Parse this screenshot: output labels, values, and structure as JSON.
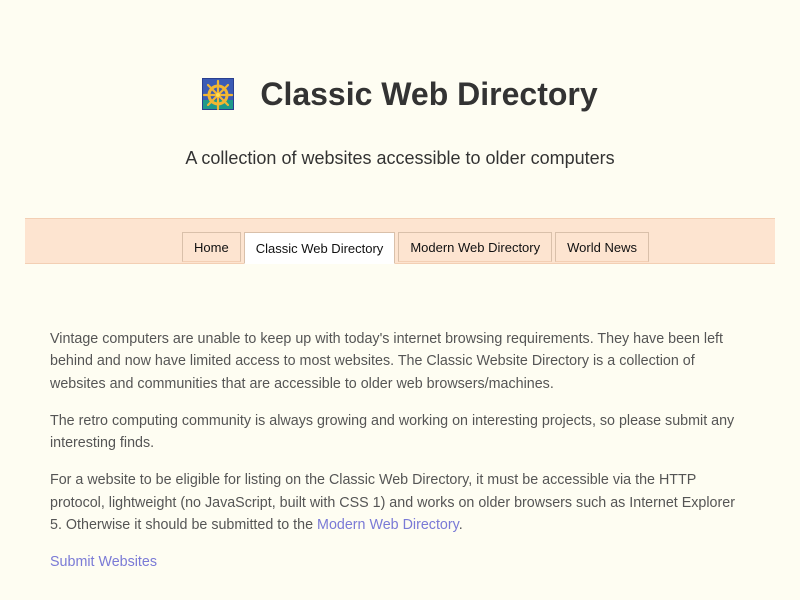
{
  "site": {
    "title": "Classic Web Directory",
    "tagline": "A collection of websites accessible to older computers",
    "logo_icon": "ship-wheel-icon"
  },
  "nav": {
    "tabs": [
      {
        "label": "Home",
        "active": false
      },
      {
        "label": "Classic Web Directory",
        "active": true
      },
      {
        "label": "Modern Web Directory",
        "active": false
      },
      {
        "label": "World News",
        "active": false
      }
    ]
  },
  "content": {
    "paragraph1": "Vintage computers are unable to keep up with today's internet browsing requirements. They have been left behind and now have limited access to most websites. The Classic Website Directory is a collection of websites and communities that are accessible to older web browsers/machines.",
    "paragraph2": "The retro computing community is always growing and working on interesting projects, so please submit any interesting finds.",
    "paragraph3_before": "For a website to be eligible for listing on the Classic Web Directory, it must be accessible via the HTTP protocol, lightweight (no JavaScript, built with CSS 1) and works on older browsers such as Internet Explorer 5. Otherwise it should be submitted to the ",
    "paragraph3_link": "Modern Web Directory",
    "paragraph3_after": ".",
    "submit_link": "Submit Websites"
  },
  "colors": {
    "background": "#fefdf2",
    "nav_background": "#fde4d0",
    "link": "#7a7ad6",
    "body_text": "#555555",
    "heading_text": "#333333"
  }
}
